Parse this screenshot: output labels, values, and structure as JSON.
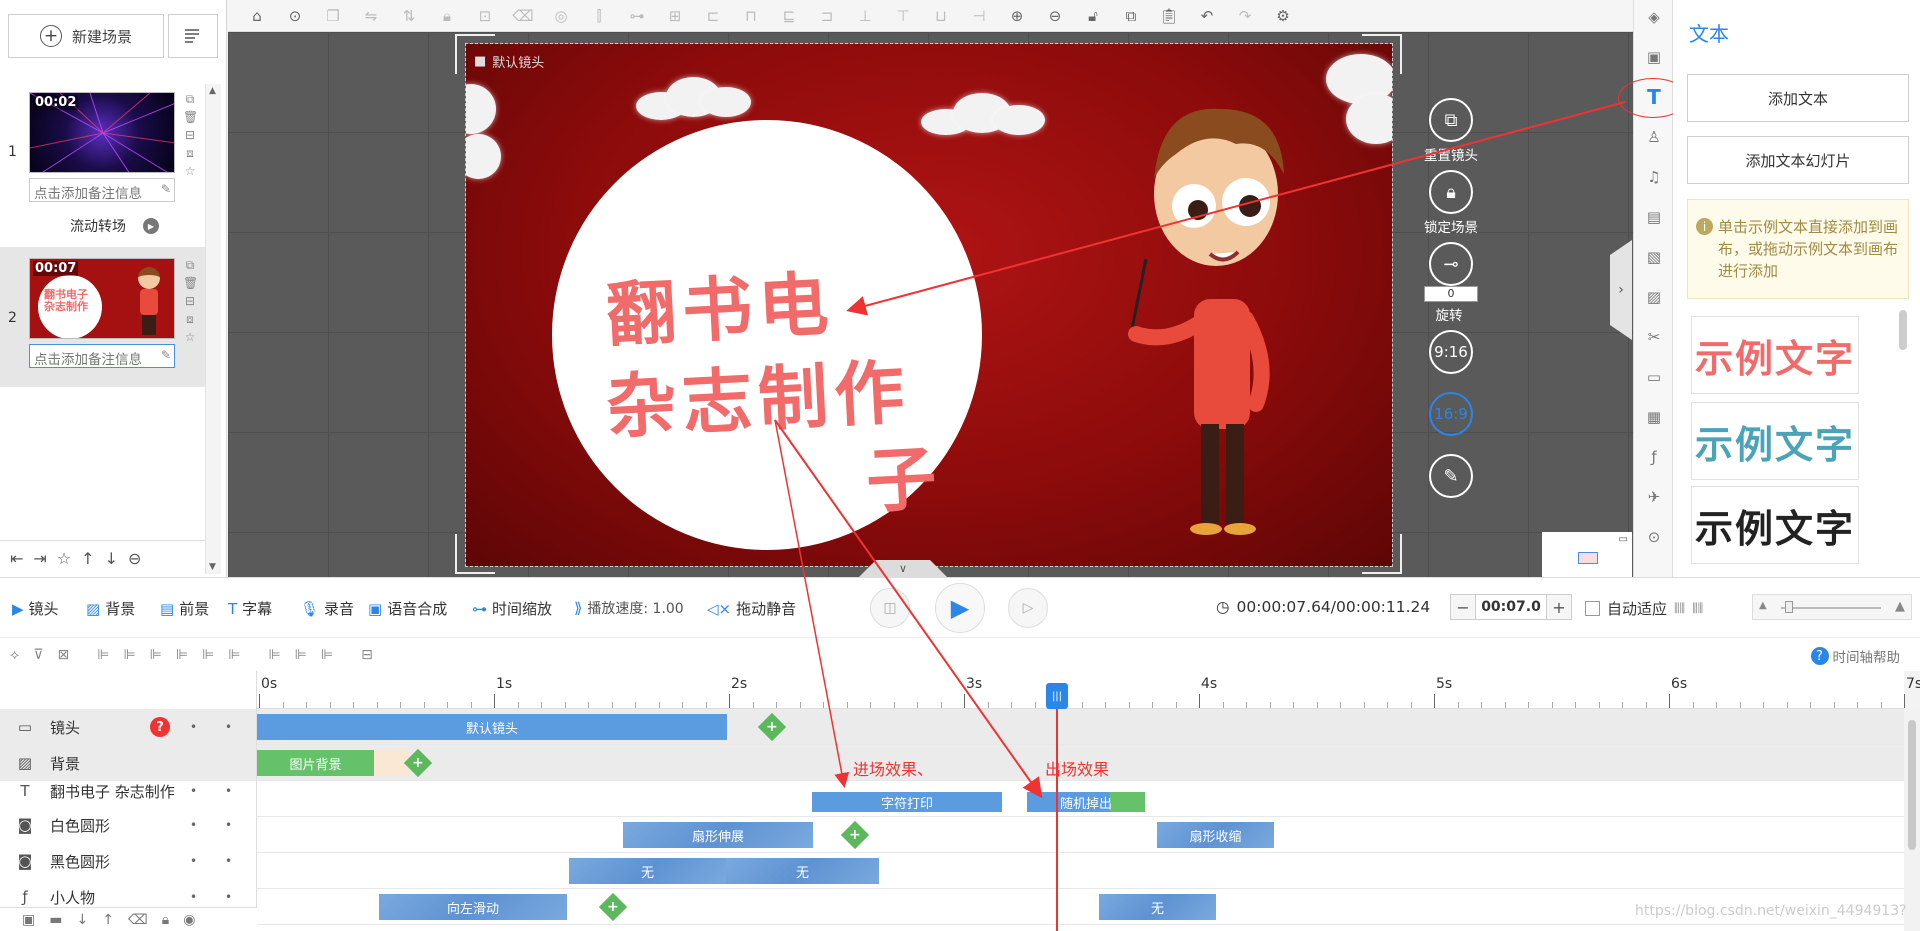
{
  "scene_panel": {
    "new_scene_label": "新建场景",
    "scenes": [
      {
        "number": "1",
        "duration": "00:02",
        "note_placeholder": "点击添加备注信息"
      },
      {
        "number": "2",
        "duration": "00:07",
        "note_placeholder": "点击添加备注信息"
      }
    ],
    "transition_label": "流动转场"
  },
  "canvas": {
    "camera_label": "默认镜头",
    "title_line1": "翻书电",
    "title_line2": "杂志制作",
    "title_line3": "子",
    "controls": {
      "reset_camera": "重置镜头",
      "lock_scene": "锁定场景",
      "rotate_value": "0",
      "rotate_label": "旋转",
      "ratio_916": "9:16",
      "ratio_169": "16:9"
    }
  },
  "text_panel": {
    "title": "文本",
    "add_text": "添加文本",
    "add_text_slide": "添加文本幻灯片",
    "hint": "单击示例文本直接添加到画布，或拖动示例文本到画布进行添加",
    "samples": [
      {
        "text": "示例文字",
        "color": "#f26b6b"
      },
      {
        "text": "示例文字",
        "color": "#4aa3b8"
      },
      {
        "text": "示例文字",
        "color": "#222222"
      }
    ]
  },
  "control_bar": {
    "camera": "镜头",
    "background": "背景",
    "foreground": "前景",
    "subtitle": "字幕",
    "record": "录音",
    "tts": "语音合成",
    "time_zoom": "时间缩放",
    "play_speed": "播放速度: 1.00",
    "drag_mute": "拖动静音",
    "time_current_total": "00:00:07.64/00:00:11.24",
    "stepper_value": "00:07.0",
    "auto_fit": "自动适应"
  },
  "timeline": {
    "help": "时间轴帮助",
    "ticks": [
      "0s",
      "1s",
      "2s",
      "3s",
      "4s",
      "5s",
      "6s",
      "7s"
    ],
    "tracks": [
      {
        "name": "镜头"
      },
      {
        "name": "背景"
      },
      {
        "name": "翻书电子 杂志制作"
      },
      {
        "name": "白色圆形"
      },
      {
        "name": "黑色圆形"
      },
      {
        "name": "小人物"
      }
    ],
    "clips": {
      "camera_default": "默认镜头",
      "bg_image": "图片背景",
      "text_in": "字符打印",
      "text_out": "随机掉出",
      "white_in": "扇形伸展",
      "white_out": "扇形收缩",
      "black_a": "无",
      "black_b": "无",
      "char_in": "向左滑动",
      "char_out": "无"
    },
    "annotations": {
      "entry_effect": "进场效果、",
      "exit_effect": "出场效果"
    }
  },
  "watermark": "https://blog.csdn.net/weixin_4494913?"
}
